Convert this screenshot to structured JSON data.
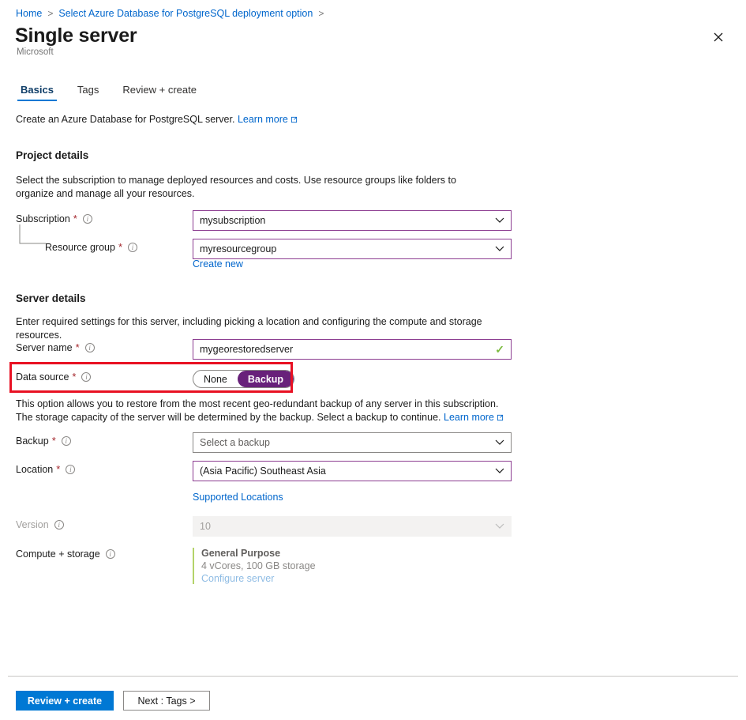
{
  "breadcrumb": {
    "items": [
      {
        "label": "Home"
      },
      {
        "label": "Select Azure Database for PostgreSQL deployment option"
      }
    ],
    "separator": ">"
  },
  "header": {
    "title": "Single server",
    "publisher": "Microsoft",
    "close_label": "✕"
  },
  "tabs": [
    {
      "label": "Basics",
      "active": true
    },
    {
      "label": "Tags",
      "active": false
    },
    {
      "label": "Review + create",
      "active": false
    }
  ],
  "intro": {
    "text": "Create an Azure Database for PostgreSQL server.",
    "link": "Learn more"
  },
  "project_details": {
    "heading": "Project details",
    "description": "Select the subscription to manage deployed resources and costs. Use resource groups like folders to organize and manage all your resources.",
    "subscription": {
      "label": "Subscription",
      "required": "*",
      "value": "mysubscription"
    },
    "resource_group": {
      "label": "Resource group",
      "required": "*",
      "value": "myresourcegroup",
      "create_new": "Create new"
    }
  },
  "server_details": {
    "heading": "Server details",
    "description": "Enter required settings for this server, including picking a location and configuring the compute and storage resources.",
    "server_name": {
      "label": "Server name",
      "required": "*",
      "value": "mygeorestoredserver",
      "valid_mark": "✓"
    },
    "data_source": {
      "label": "Data source",
      "required": "*",
      "options": [
        {
          "label": "None",
          "selected": false
        },
        {
          "label": "Backup",
          "selected": true
        }
      ],
      "selected": "Backup",
      "help_text": "This option allows you to restore from the most recent geo-redundant backup of any server in this subscription. The storage capacity of the server will be determined by the backup. Select a backup to continue.",
      "help_link": "Learn more",
      "highlight_color": "#e81123"
    },
    "backup": {
      "label": "Backup",
      "required": "*",
      "placeholder": "Select a backup",
      "value": ""
    },
    "location": {
      "label": "Location",
      "required": "*",
      "value": "(Asia Pacific) Southeast Asia",
      "supported_locations": "Supported Locations"
    },
    "version": {
      "label": "Version",
      "value": "10",
      "disabled": true
    },
    "compute_storage": {
      "label": "Compute + storage",
      "tier": "General Purpose",
      "specs": "4 vCores, 100 GB storage",
      "configure_link": "Configure server"
    }
  },
  "footer": {
    "review_create": "Review + create",
    "next": "Next : Tags >"
  },
  "colors": {
    "accent_blue": "#0078d4",
    "link_blue": "#0066cc",
    "field_purple": "#8c3d91",
    "toggle_purple": "#68217a",
    "required_red": "#a4262c",
    "annotation_red": "#e81123",
    "valid_green": "#7cbb3f"
  }
}
